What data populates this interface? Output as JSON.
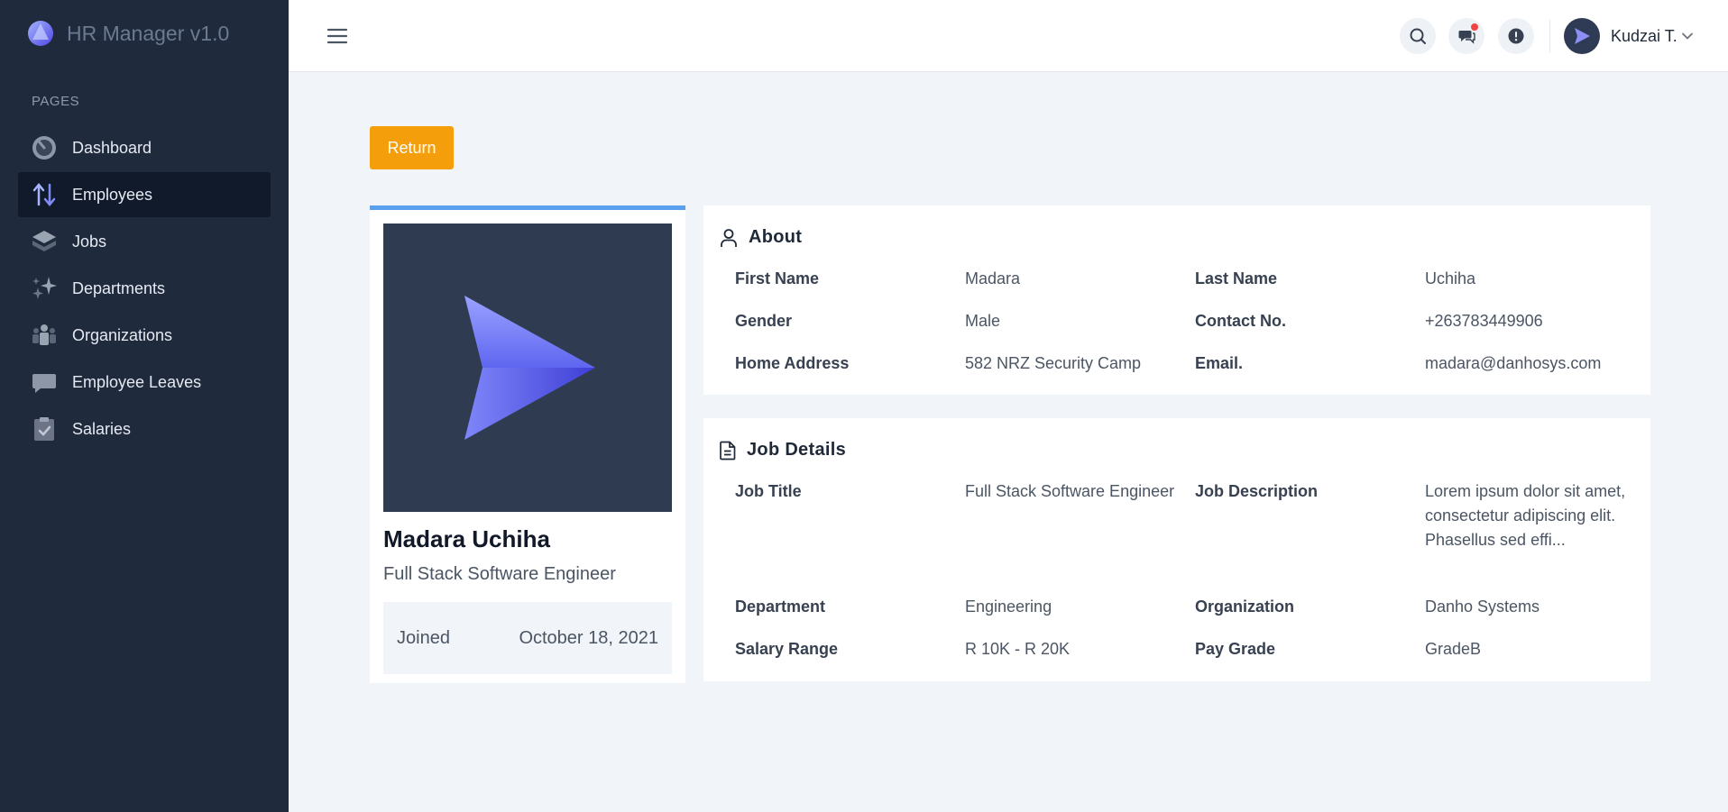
{
  "app": {
    "title": "HR Manager v1.0"
  },
  "sidebar": {
    "section_label": "PAGES",
    "items": [
      {
        "label": "Dashboard",
        "icon": "dashboard-icon"
      },
      {
        "label": "Employees",
        "icon": "sort-arrows-icon",
        "active": true
      },
      {
        "label": "Jobs",
        "icon": "layers-icon"
      },
      {
        "label": "Departments",
        "icon": "sparkles-icon"
      },
      {
        "label": "Organizations",
        "icon": "people-icon"
      },
      {
        "label": "Employee Leaves",
        "icon": "chat-bubble-icon"
      },
      {
        "label": "Salaries",
        "icon": "clipboard-check-icon"
      }
    ]
  },
  "header": {
    "user_name": "Kudzai T.",
    "notification_color": "#ef4444"
  },
  "actions": {
    "return_label": "Return"
  },
  "profile": {
    "name": "Madara Uchiha",
    "role": "Full Stack Software Engineer",
    "joined_label": "Joined",
    "joined_date": "October 18, 2021"
  },
  "about": {
    "title": "About",
    "fields": [
      {
        "label": "First Name",
        "value": "Madara"
      },
      {
        "label": "Last Name",
        "value": "Uchiha"
      },
      {
        "label": "Gender",
        "value": "Male"
      },
      {
        "label": "Contact No.",
        "value": "+263783449906"
      },
      {
        "label": "Home Address",
        "value": "582 NRZ Security Camp"
      },
      {
        "label": "Email.",
        "value": "madara@danhosys.com"
      }
    ]
  },
  "job": {
    "title": "Job Details",
    "fields": [
      {
        "label": "Job Title",
        "value": "Full Stack Software Engineer"
      },
      {
        "label": "Job Description",
        "value": "Lorem ipsum dolor sit amet, consectetur adipiscing elit. Phasellus sed effi..."
      },
      {
        "label": "Department",
        "value": "Engineering"
      },
      {
        "label": "Organization",
        "value": "Danho Systems"
      },
      {
        "label": "Salary Range",
        "value": "R 10K - R 20K"
      },
      {
        "label": "Pay Grade",
        "value": "GradeB"
      }
    ]
  },
  "colors": {
    "sidebar_bg": "#1f2a3d",
    "accent_orange": "#f59e0b",
    "accent_blue": "#5aa0ee",
    "brand_indigo": "#6366f1"
  }
}
